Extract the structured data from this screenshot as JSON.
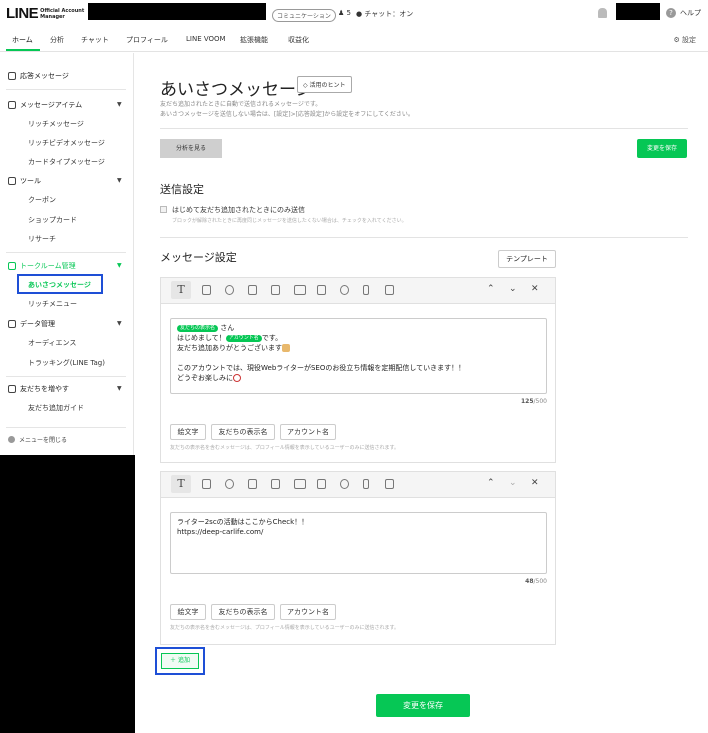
{
  "header": {
    "logo_big": "LINE",
    "logo_small_1": "Official Account",
    "logo_small_2": "Manager",
    "status_pill": "コミュニケーション",
    "friend_count": "5",
    "chat_status": "チャット：オン",
    "help": "ヘルプ"
  },
  "nav": {
    "items": [
      "ホーム",
      "分析",
      "チャット",
      "プロフィール",
      "LINE VOOM",
      "拡張機能",
      "収益化"
    ],
    "settings": "設定"
  },
  "sidebar": {
    "auto_response": "応答メッセージ",
    "message_items": "メッセージアイテム",
    "rich_message": "リッチメッセージ",
    "rich_video_message": "リッチビデオメッセージ",
    "card_message": "カードタイプメッセージ",
    "tools": "ツール",
    "coupon": "クーポン",
    "shop_card": "ショップカード",
    "research": "リサーチ",
    "talkroom": "トークルーム管理",
    "greeting": "あいさつメッセージ",
    "rich_menu": "リッチメニュー",
    "data": "データ管理",
    "audience": "オーディエンス",
    "tracking": "トラッキング(LINE Tag)",
    "grow_friends": "友だちを増やす",
    "friend_guide": "友だち追加ガイド",
    "close_menu": "メニューを閉じる"
  },
  "page": {
    "title": "あいさつメッセージ",
    "hint_button": "活用のヒント",
    "desc_1": "友だち追加されたときに自動で送信されるメッセージです。",
    "desc_2": "あいさつメッセージを送信しない場合は、[設定]>[応答設定]から設定をオフにしてください。",
    "analysis_button": "分析を見る",
    "save_button_small": "変更を保存",
    "send_settings_title": "送信設定",
    "checkbox_label": "はじめて友だち追加されたときにのみ送信",
    "checkbox_sub": "ブロックが解除されたときに再度同じメッセージを送信したくない場合は、チェックを入れてください。",
    "message_settings_title": "メッセージ設定",
    "template_button": "テンプレート",
    "add_button": "＋ 追加",
    "save_button_big": "変更を保存"
  },
  "message1": {
    "tag_friend": "友だちの表示名",
    "line1_suffix": "さん",
    "line2_prefix": "はじめまして！",
    "tag_account": "アカウント名",
    "line2_suffix": "です。",
    "line3": "友だち追加ありがとうございます",
    "line5": "このアカウントでは、現役WebライターがSEOのお役立ち情報を定期配信していきます！！",
    "line6": "どうぞお楽しみに",
    "count": "125",
    "max": "/500"
  },
  "message2": {
    "line1": "ライター2scの活動はここからCheck！！",
    "line2": "https://deep-carlife.com/",
    "count": "48",
    "max": "/500"
  },
  "insert": {
    "emoji": "絵文字",
    "friend_name": "友だちの表示名",
    "account_name": "アカウント名",
    "note": "友だちの表示名を含むメッセージは、プロフィール情報を表示しているユーザーのみに送信されます。"
  },
  "colors": {
    "accent": "#06c755",
    "highlight": "#1e4fd6"
  }
}
